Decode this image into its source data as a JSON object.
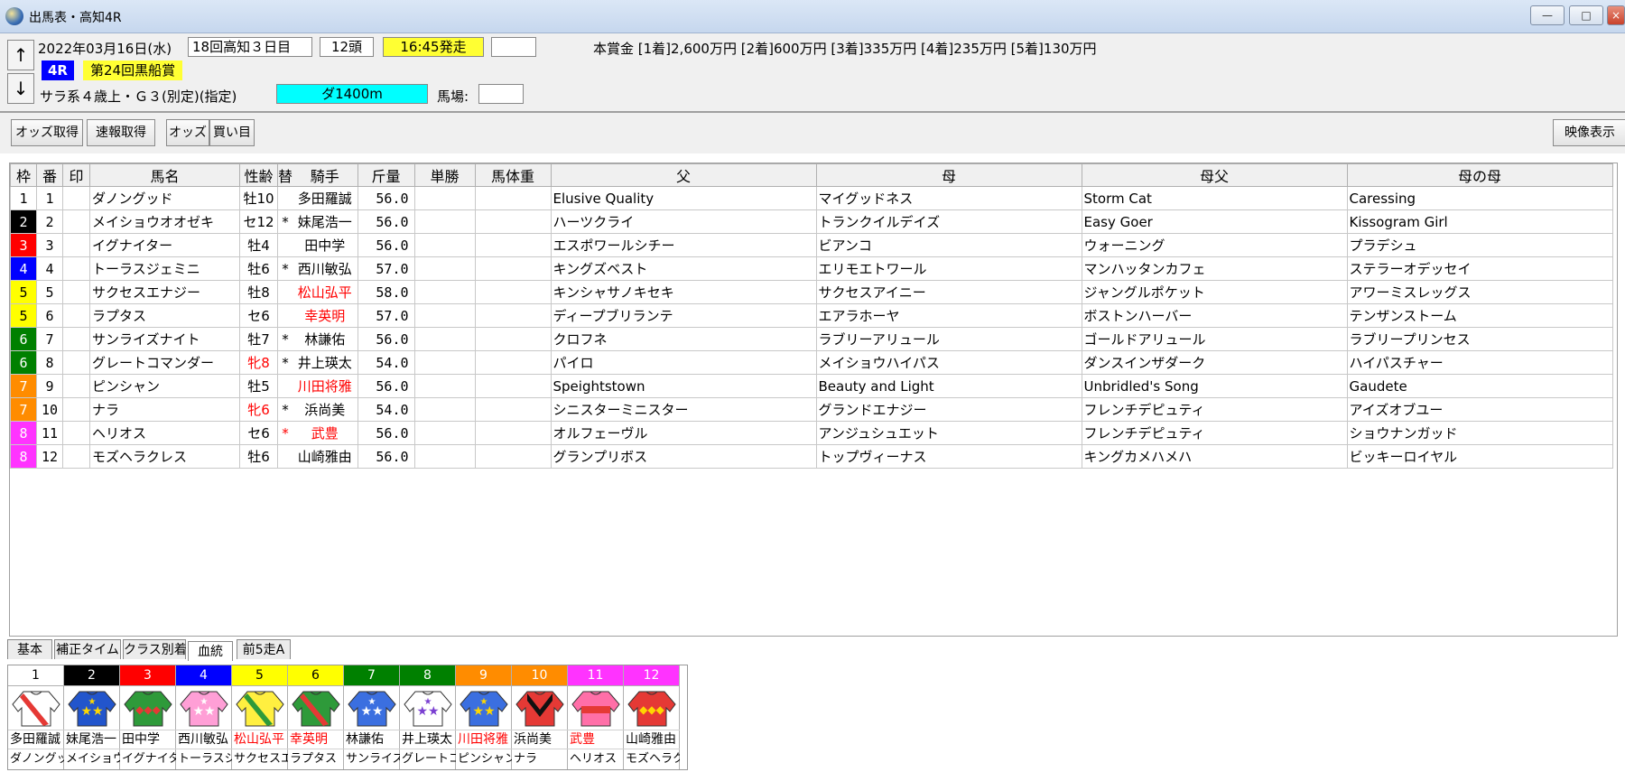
{
  "window": {
    "title": "出馬表・高知4R",
    "minimize": "—",
    "maximize": "□",
    "close": "×"
  },
  "header": {
    "date": "2022年03月16日(水)",
    "meeting": "18回高知３日目",
    "heads": "12頭",
    "start_time": "16:45発走",
    "race_no": "4R",
    "race_name": "第24回黒船賞",
    "conditions": "サラ系４歳上・Ｇ３(別定)(指定)",
    "distance": "ダ1400m",
    "track_label": "馬場:",
    "prize": "本賞金 [1着]2,600万円 [2着]600万円 [3着]335万円 [4着]235万円 [5着]130万円",
    "up_arrow": "↑",
    "down_arrow": "↓"
  },
  "toolbar": {
    "odds_fetch": "オッズ取得",
    "quinella_fetch": "速報取得",
    "odds": "オッズ",
    "bets": "買い目",
    "video": "映像表示"
  },
  "table": {
    "columns": [
      "枠",
      "番",
      "印",
      "馬名",
      "性齢",
      "替",
      "騎手",
      "斤量",
      "単勝",
      "馬体重",
      "父",
      "母",
      "母父",
      "母の母"
    ],
    "rows": [
      {
        "waku": "1",
        "ban": "1",
        "horse": "ダノングッド",
        "sexage": "牡10",
        "swap": "",
        "jockey": "多田羅誠",
        "weight": "56.0",
        "sire": "Elusive Quality",
        "dam": "マイグッドネス",
        "damsire": "Storm Cat",
        "damdam": "Caressing"
      },
      {
        "waku": "2",
        "ban": "2",
        "horse": "メイショウオオゼキ",
        "sexage": "セ12",
        "swap": "*",
        "jockey": "妹尾浩一",
        "weight": "56.0",
        "sire": "ハーツクライ",
        "dam": "トランクイルデイズ",
        "damsire": "Easy Goer",
        "damdam": "Kissogram Girl"
      },
      {
        "waku": "3",
        "ban": "3",
        "horse": "イグナイター",
        "sexage": "牡4",
        "swap": "",
        "jockey": "田中学",
        "weight": "56.0",
        "sire": "エスポワールシチー",
        "dam": "ビアンコ",
        "damsire": "ウォーニング",
        "damdam": "プラデシュ"
      },
      {
        "waku": "4",
        "ban": "4",
        "horse": "トーラスジェミニ",
        "sexage": "牡6",
        "swap": "*",
        "jockey": "西川敏弘",
        "weight": "57.0",
        "sire": "キングズベスト",
        "dam": "エリモエトワール",
        "damsire": "マンハッタンカフェ",
        "damdam": "ステラーオデッセイ"
      },
      {
        "waku": "5",
        "ban": "5",
        "horse": "サクセスエナジー",
        "sexage": "牡8",
        "swap": "",
        "jockey": "松山弘平",
        "weight": "58.0",
        "sire": "キンシャサノキセキ",
        "dam": "サクセスアイニー",
        "damsire": "ジャングルポケット",
        "damdam": "アワーミスレッグス"
      },
      {
        "waku": "5",
        "ban": "6",
        "horse": "ラプタス",
        "sexage": "セ6",
        "swap": "",
        "jockey": "幸英明",
        "weight": "57.0",
        "sire": "ディープブリランテ",
        "dam": "エアラホーヤ",
        "damsire": "ボストンハーバー",
        "damdam": "テンザンストーム"
      },
      {
        "waku": "6",
        "ban": "7",
        "horse": "サンライズナイト",
        "sexage": "牡7",
        "swap": "*",
        "jockey": "林謙佑",
        "weight": "56.0",
        "sire": "クロフネ",
        "dam": "ラブリーアリュール",
        "damsire": "ゴールドアリュール",
        "damdam": "ラブリープリンセス"
      },
      {
        "waku": "6",
        "ban": "8",
        "horse": "グレートコマンダー",
        "sexage": "牝8",
        "swap": "*",
        "jockey": "井上瑛太",
        "weight": "54.0",
        "sire": "パイロ",
        "dam": "メイショウハイパス",
        "damsire": "ダンスインザダーク",
        "damdam": "ハイパスチャー"
      },
      {
        "waku": "7",
        "ban": "9",
        "horse": "ピンシャン",
        "sexage": "牡5",
        "swap": "",
        "jockey": "川田将雅",
        "weight": "56.0",
        "sire": "Speightstown",
        "dam": "Beauty and Light",
        "damsire": "Unbridled's Song",
        "damdam": "Gaudete"
      },
      {
        "waku": "7",
        "ban": "10",
        "horse": "ナラ",
        "sexage": "牝6",
        "swap": "*",
        "jockey": "浜尚美",
        "weight": "54.0",
        "sire": "シニスターミニスター",
        "dam": "グランドエナジー",
        "damsire": "フレンチデピュティ",
        "damdam": "アイズオブユー"
      },
      {
        "waku": "8",
        "ban": "11",
        "horse": "ヘリオス",
        "sexage": "セ6",
        "swap": "*",
        "jockey": "武豊",
        "weight": "56.0",
        "sire": "オルフェーヴル",
        "dam": "アンジュシュエット",
        "damsire": "フレンチデピュティ",
        "damdam": "ショウナンガッド"
      },
      {
        "waku": "8",
        "ban": "12",
        "horse": "モズヘラクレス",
        "sexage": "牡6",
        "swap": "",
        "jockey": "山崎雅由",
        "weight": "56.0",
        "sire": "グランプリボス",
        "dam": "トップヴィーナス",
        "damsire": "キングカメハメハ",
        "damdam": "ビッキーロイヤル"
      }
    ]
  },
  "tabs": [
    "基本",
    "補正タイム",
    "クラス別着",
    "血統",
    "前5走A"
  ],
  "silks": [
    {
      "num": "1",
      "jockey": "多田羅誠",
      "horse": "ダノングッド"
    },
    {
      "num": "2",
      "jockey": "妹尾浩一",
      "horse": "メイショウオオゼキ"
    },
    {
      "num": "3",
      "jockey": "田中学",
      "horse": "イグナイター"
    },
    {
      "num": "4",
      "jockey": "西川敏弘",
      "horse": "トーラスジェミニ"
    },
    {
      "num": "5",
      "jockey": "松山弘平",
      "horse": "サクセスエナジー"
    },
    {
      "num": "6",
      "jockey": "幸英明",
      "horse": "ラプタス"
    },
    {
      "num": "7",
      "jockey": "林謙佑",
      "horse": "サンライズナイト"
    },
    {
      "num": "8",
      "jockey": "井上瑛太",
      "horse": "グレートコマンダー"
    },
    {
      "num": "9",
      "jockey": "川田将雅",
      "horse": "ピンシャン"
    },
    {
      "num": "10",
      "jockey": "浜尚美",
      "horse": "ナラ"
    },
    {
      "num": "11",
      "jockey": "武豊",
      "horse": "ヘリオス"
    },
    {
      "num": "12",
      "jockey": "山崎雅由",
      "horse": "モズヘラクレス"
    }
  ],
  "colors": {
    "waku": {
      "1": "#ffffff",
      "2": "#000000",
      "3": "#ff0000",
      "4": "#0000ff",
      "5": "#ffff00",
      "6": "#008000",
      "7": "#ff8c00",
      "8": "#ff33ff"
    },
    "waku_text": {
      "1": "#000000",
      "2": "#ffffff",
      "3": "#ffffff",
      "4": "#ffffff",
      "5": "#000000",
      "6": "#ffffff",
      "7": "#ffffff",
      "8": "#ffffff"
    },
    "accent_red": "#ff0000",
    "start_yellow": "#ffff33",
    "distance_cyan": "#00ffff"
  },
  "red_jockeys": [
    "5",
    "6",
    "9",
    "11"
  ],
  "red_sexage": [
    "8",
    "10"
  ]
}
